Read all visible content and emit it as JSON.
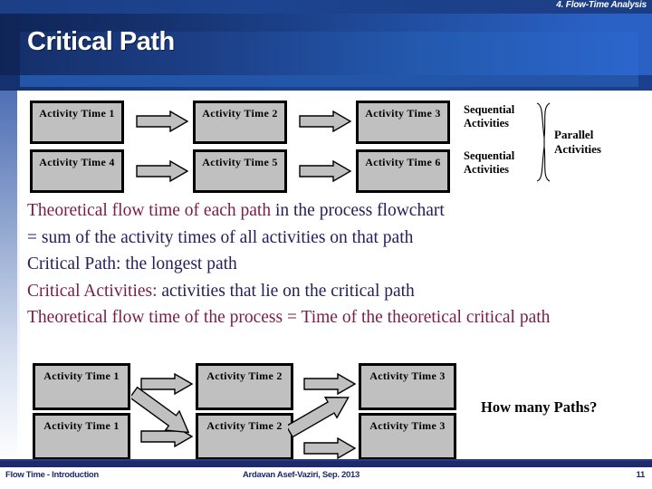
{
  "header": {
    "section_label": "4. Flow-Time Analysis",
    "title": "Critical Path"
  },
  "diagram_top": {
    "rows": [
      {
        "boxes": [
          "Activity Time 1",
          "Activity Time 2",
          "Activity Time 3"
        ],
        "group_label_line1": "Sequential",
        "group_label_line2": "Activities"
      },
      {
        "boxes": [
          "Activity Time 4",
          "Activity Time 5",
          "Activity Time 6"
        ],
        "group_label_line1": "Sequential",
        "group_label_line2": "Activities"
      }
    ],
    "parallel_label_line1": "Parallel",
    "parallel_label_line2": "Activities"
  },
  "body": {
    "lines": [
      {
        "part1": "Theoretical flow time of each path",
        "part2": " in the process flowchart"
      },
      {
        "part1": "",
        "part2": "= sum of the activity times of all activities on that path"
      },
      {
        "part1": "",
        "part2": "Critical Path: the longest path"
      },
      {
        "part1": "Critical Activities:",
        "part2": " activities that lie on the critical path"
      },
      {
        "part1": "Theoretical flow time of the process = Time of the theoretical critical path",
        "part2": ""
      }
    ]
  },
  "diagram_bottom": {
    "rows": [
      {
        "boxes": [
          "Activity Time 1",
          "Activity Time 2",
          "Activity Time 3"
        ]
      },
      {
        "boxes": [
          "Activity Time 1",
          "Activity Time 2",
          "Activity Time 3"
        ]
      }
    ],
    "question": "How many Paths?"
  },
  "footer": {
    "left": "Flow Time - Introduction",
    "center": "Ardavan Asef-Vaziri, Sep. 2013",
    "right": "11"
  },
  "colors": {
    "banner_dark": "#15306b",
    "banner_light": "#2c66cd",
    "text_maroon": "#7a1d46",
    "text_navy": "#232158",
    "box_fill": "#c0c0c0",
    "footer": "#1e2a6b"
  }
}
